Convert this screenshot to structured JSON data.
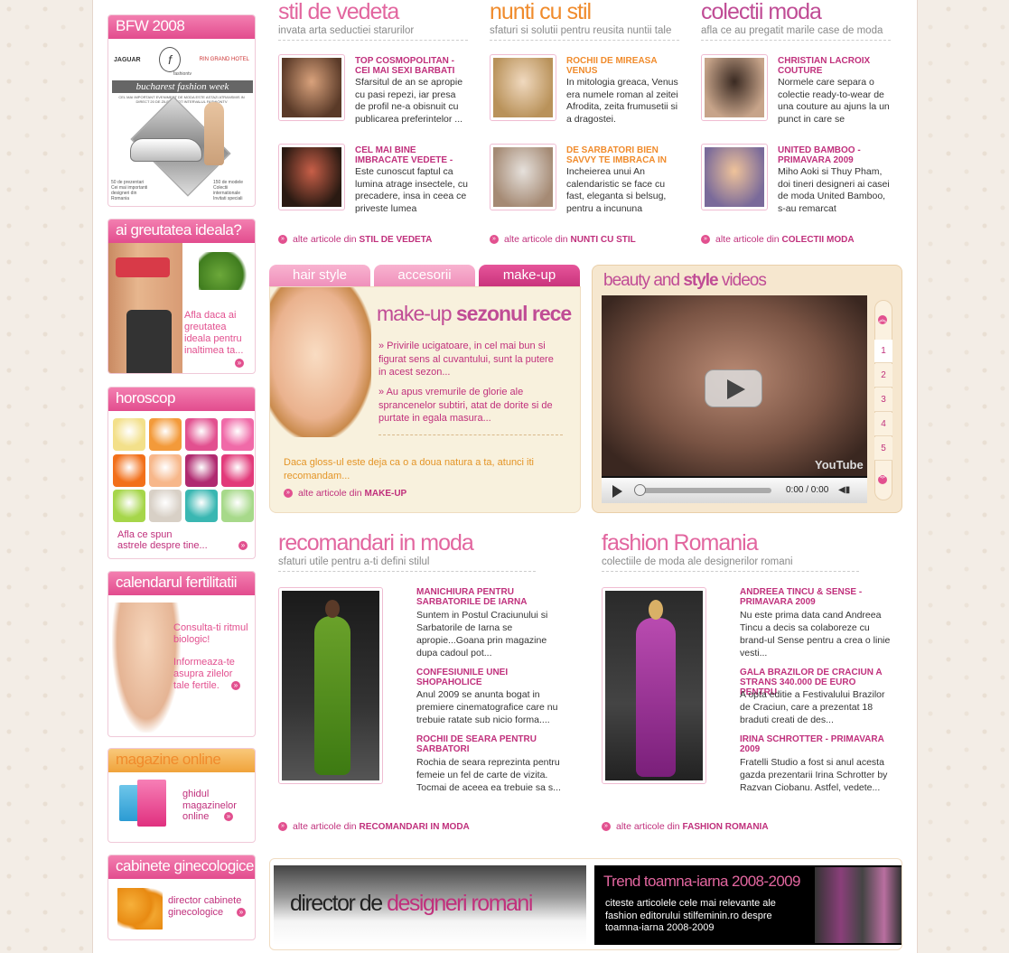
{
  "sidebar": {
    "bfw": {
      "title": "BFW 2008",
      "banner_title": "bucharest fashion week",
      "sponsor1": "JAGUAR",
      "sponsor2": "fashiontv",
      "sponsor3": "RIN GRAND HOTEL",
      "brand": "fashiontv",
      "brand_letter": "f",
      "info_left1": "50 de prezentari",
      "info_left2": "Cei mai importanti designeri din Romania",
      "info_right1": "150 de modele",
      "info_right2": "Colectii internationale",
      "info_right3": "Invitati speciali",
      "intro_text": "CEL MAI IMPORTANT EVENIMENT DE MODA ESTE ASTAZI ATRANSMIS IN DIRECT 20 DE ZILE PE TOT INTERVALUL FASHIONTV"
    },
    "weight": {
      "title": "ai greutatea ideala?",
      "text": "Afla daca ai greutatea ideala pentru inaltimea ta..."
    },
    "horoscope": {
      "title": "horoscop",
      "text1": "Afla ce spun",
      "text2": "astrele despre tine..."
    },
    "fertility": {
      "title": "calendarul fertilitatii",
      "text1": "Consulta-ti ritmul biologic!",
      "text2": "Informeaza-te asupra zilelor tale fertile."
    },
    "shops": {
      "title": "magazine online",
      "text": "ghidul magazinelor online"
    },
    "gyn": {
      "title": "cabinete ginecologice",
      "text": "director cabinete ginecologice"
    }
  },
  "columns": [
    {
      "title": "stil de vedeta",
      "color": "#e2669f",
      "subtitle": "invata arta seductiei starurilor",
      "articles": [
        {
          "title": "TOP COSMOPOLITAN - CEI MAI SEXI BARBATI",
          "text": "Sfarsitul de an se apropie cu pasi repezi, iar presa de profil ne-a obisnuit cu publicarea preferintelor ..."
        },
        {
          "title": "CEL MAI BINE IMBRACATE VEDETE -",
          "text": "Este cunoscut faptul ca lumina atrage insectele, cu precadere, insa in ceea ce priveste lumea"
        }
      ],
      "more_prefix": "alte articole din",
      "more_label": "STIL DE VEDETA"
    },
    {
      "title": "nunti cu stil",
      "color": "#f08b2c",
      "subtitle": "sfaturi si solutii pentru reusita nuntii tale",
      "articles": [
        {
          "title": "ROCHII DE MIREASA VENUS",
          "text": "In mitologia greaca, Venus era numele roman al zeitei Afrodita, zeita frumusetii si a dragostei."
        },
        {
          "title": "DE SARBATORI BIEN SAVVY TE IMBRACA IN",
          "text": "Incheierea unui An calendaristic se face cu fast, eleganta si belsug, pentru a incununa"
        }
      ],
      "more_prefix": "alte articole din",
      "more_label": "NUNTI CU STIL"
    },
    {
      "title": "colectii moda",
      "color": "#c04c95",
      "subtitle": "afla ce au pregatit marile case de moda",
      "articles": [
        {
          "title": "CHRISTIAN LACROIX COUTURE",
          "text": "Normele care separa o colectie ready-to-wear de una couture au ajuns la un punct in care se"
        },
        {
          "title": "UNITED BAMBOO - PRIMAVARA 2009",
          "text": "Miho Aoki si Thuy Pham, doi tineri designeri ai casei de moda United Bamboo, s-au remarcat"
        }
      ],
      "more_prefix": "alte articole din",
      "more_label": "COLECTII MODA"
    }
  ],
  "tabs": [
    {
      "label": "hair style"
    },
    {
      "label": "accesorii"
    },
    {
      "label": "make-up"
    }
  ],
  "makeup": {
    "title_a": "make-up",
    "title_b": "sezonul rece",
    "bullet1": "» Privirile ucigatoare, in cel mai bun si figurat sens al cuvantului, sunt la putere in acest sezon...",
    "bullet2": "» Au apus vremurile de glorie ale sprancenelor subtiri, atat de dorite si de purtate in egala masura...",
    "footer": "Daca gloss-ul este deja ca o a doua natura a ta, atunci iti recomandam...",
    "more_prefix": "alte articole din",
    "more_label": "MAKE-UP"
  },
  "videos": {
    "title_a": "beauty and",
    "title_b": "style",
    "title_c": "videos",
    "time": "0:00 / 0:00",
    "logo": "YouTube",
    "pages": [
      "1",
      "2",
      "3",
      "4",
      "5"
    ]
  },
  "reco": {
    "title": "recomandari in moda",
    "subtitle": "sfaturi utile pentru a-ti defini stilul",
    "articles": [
      {
        "title": "MANICHIURA PENTRU SARBATORILE DE IARNA",
        "text": "Suntem in Postul Craciunului si Sarbatorile de Iarna se apropie...Goana prin magazine dupa cadoul pot..."
      },
      {
        "title": "CONFESIUNILE UNEI SHOPAHOLICE",
        "text": "Anul 2009 se anunta bogat in premiere cinematografice care nu trebuie ratate sub nicio forma...."
      },
      {
        "title": "ROCHII DE SEARA PENTRU SARBATORI",
        "text": "Rochia de seara reprezinta pentru femeie un fel de carte de vizita. Tocmai de aceea ea trebuie sa s..."
      }
    ],
    "more_prefix": "alte articole din",
    "more_label": "RECOMANDARI IN MODA"
  },
  "romania": {
    "title": "fashion Romania",
    "subtitle": "colectiile de moda ale designerilor romani",
    "articles": [
      {
        "title": "ANDREEA TINCU & SENSE - PRIMAVARA 2009",
        "text": "Nu este prima data cand Andreea Tincu a decis sa colaboreze cu brand-ul Sense pentru a crea o linie vesti..."
      },
      {
        "title": "GALA BRAZILOR DE CRACIUN A STRANS 340.000 DE EURO PENTRU",
        "text": "A opta editie a Festivalului Brazilor de Craciun, care a prezentat 18 braduti creati de des..."
      },
      {
        "title": "IRINA SCHROTTER - PRIMAVARA 2009",
        "text": "Fratelli Studio a fost si anul acesta gazda prezentarii Irina Schrotter by Razvan Ciobanu. Astfel, vedete..."
      }
    ],
    "more_prefix": "alte articole din",
    "more_label": "FASHION ROMANIA"
  },
  "banners": {
    "designers_a": "director de",
    "designers_b": "designeri romani",
    "trend_title": "Trend toamna-iarna 2008-2009",
    "trend_text": "citeste articolele cele mai relevante ale fashion editorului stilfeminin.ro despre toamna-iarna 2008-2009"
  }
}
